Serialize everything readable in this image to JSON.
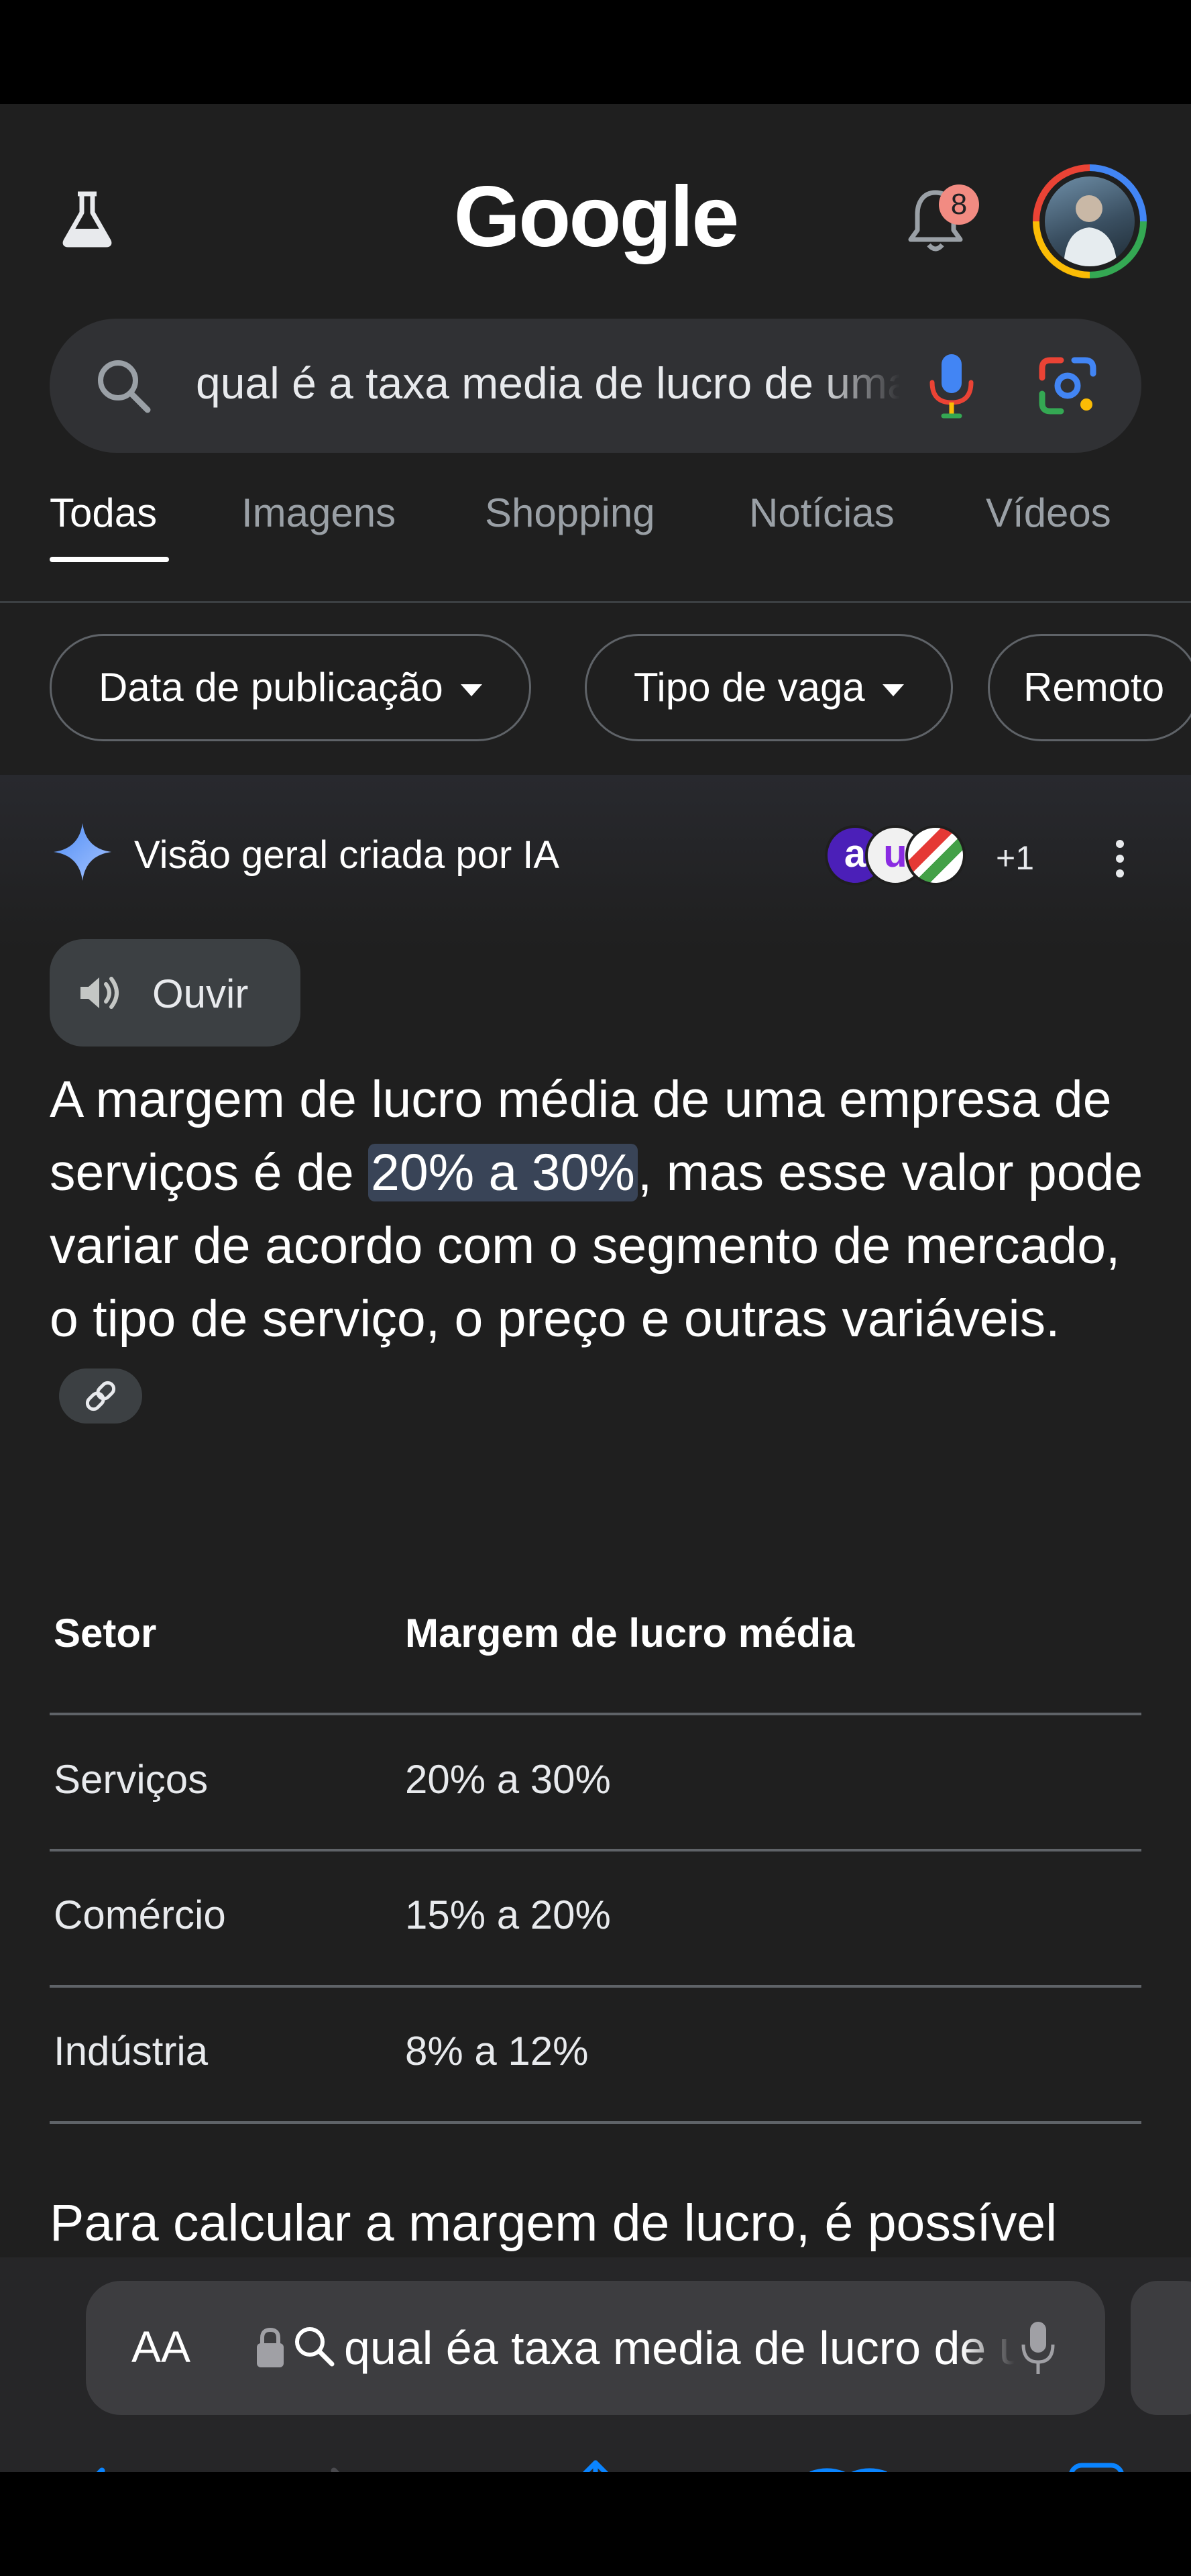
{
  "header": {
    "logo_text": "Google",
    "notification_count": "8"
  },
  "search": {
    "query": "qual é a taxa media de lucro de uma empresa de serviços"
  },
  "tabs": [
    {
      "label": "Todas",
      "active": true
    },
    {
      "label": "Imagens"
    },
    {
      "label": "Shopping"
    },
    {
      "label": "Notícias"
    },
    {
      "label": "Vídeos"
    }
  ],
  "filters": [
    {
      "label": "Data de publicação"
    },
    {
      "label": "Tipo de vaga"
    },
    {
      "label": "Remoto"
    }
  ],
  "ai_overview": {
    "title": "Visão geral criada por IA",
    "sources_extra": "+1",
    "listen_label": "Ouvir",
    "answer_part1": "A margem de lucro média de uma empresa de serviços é de ",
    "answer_highlight": "20% a 30%",
    "answer_part2": ", mas esse valor pode variar de acordo com o segmento de mercado, o tipo de serviço, o preço e outras variáveis.",
    "table": {
      "headers": [
        "Setor",
        "Margem de lucro média"
      ],
      "rows": [
        [
          "Serviços",
          "20% a 30%"
        ],
        [
          "Comércio",
          "15% a 20%"
        ],
        [
          "Indústria",
          "8% a 12%"
        ]
      ]
    },
    "continuation": "Para calcular a margem de lucro, é possível"
  },
  "browser": {
    "aa_label": "AA",
    "url_text": "qual éa taxa media de lucro de uma empresa de serviços"
  },
  "colors": {
    "background": "#1f1f1f",
    "highlight": "#394457",
    "ios_accent": "#0a84ff"
  }
}
